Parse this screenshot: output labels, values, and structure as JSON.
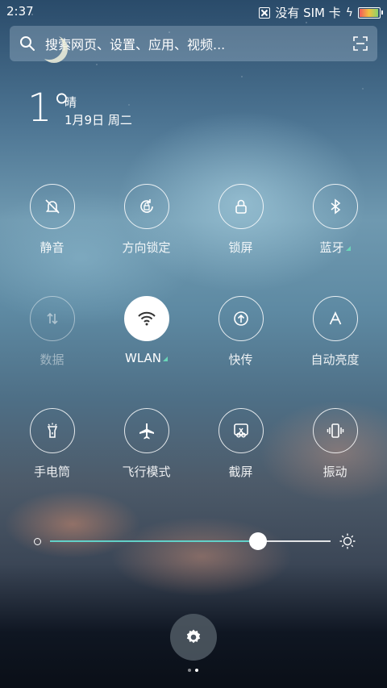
{
  "status_bar": {
    "time": "2:37",
    "carrier": "没有 SIM 卡",
    "battery_level": 0.9
  },
  "search": {
    "placeholder": "搜索网页、设置、应用、视频..."
  },
  "weather": {
    "temperature": "1°",
    "condition": "晴",
    "date": "1月9日 周二"
  },
  "toggles": [
    {
      "id": "silent",
      "label": "静音",
      "icon": "bell-off-icon",
      "state": "off"
    },
    {
      "id": "rotation-lock",
      "label": "方向锁定",
      "icon": "rotation-lock-icon",
      "state": "off"
    },
    {
      "id": "lock-screen",
      "label": "锁屏",
      "icon": "lock-icon",
      "state": "off"
    },
    {
      "id": "bluetooth",
      "label": "蓝牙",
      "icon": "bluetooth-icon",
      "state": "off",
      "has_menu": true
    },
    {
      "id": "data",
      "label": "数据",
      "icon": "data-arrows-icon",
      "state": "disabled"
    },
    {
      "id": "wlan",
      "label": "WLAN",
      "icon": "wifi-icon",
      "state": "on",
      "has_menu": true
    },
    {
      "id": "quick-share",
      "label": "快传",
      "icon": "upload-icon",
      "state": "off"
    },
    {
      "id": "auto-brightness",
      "label": "自动亮度",
      "icon": "letter-a-icon",
      "state": "off"
    },
    {
      "id": "flashlight",
      "label": "手电筒",
      "icon": "flashlight-icon",
      "state": "off"
    },
    {
      "id": "airplane",
      "label": "飞行模式",
      "icon": "airplane-icon",
      "state": "off"
    },
    {
      "id": "screenshot",
      "label": "截屏",
      "icon": "scissors-icon",
      "state": "off"
    },
    {
      "id": "vibrate",
      "label": "振动",
      "icon": "vibrate-icon",
      "state": "off"
    }
  ],
  "brightness": {
    "level": 0.74,
    "accent": "#62d1c8"
  },
  "pager": {
    "pages": 2,
    "current": 2
  }
}
